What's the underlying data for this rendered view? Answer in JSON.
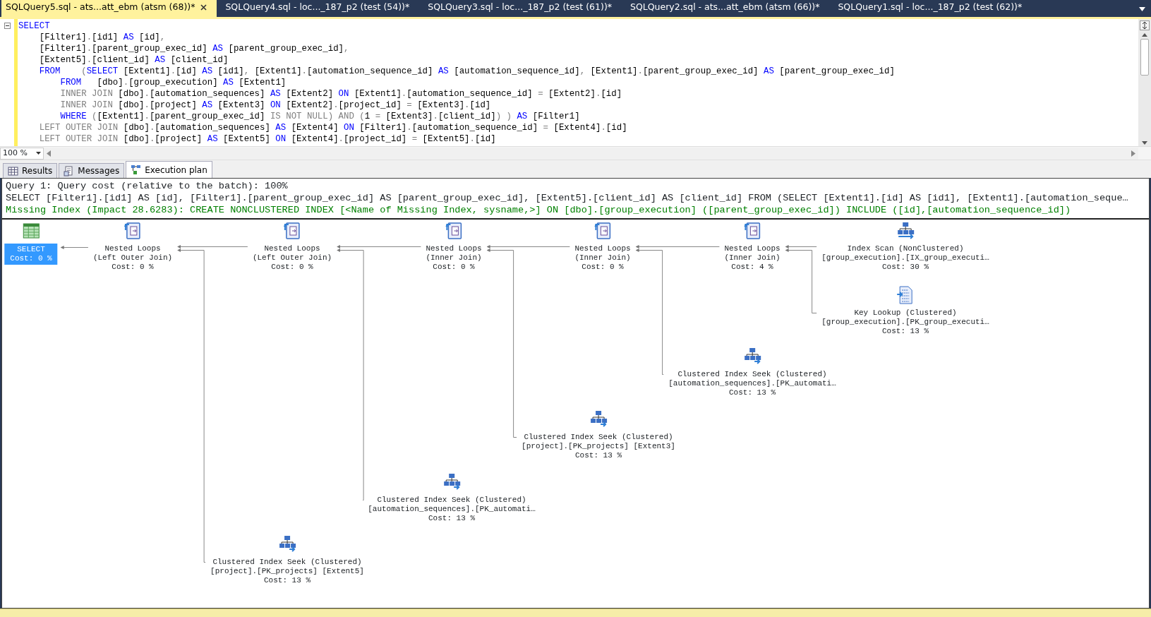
{
  "tabs": [
    {
      "label": "SQLQuery5.sql - ats...att_ebm (atsm (68))*",
      "selected": true
    },
    {
      "label": "SQLQuery4.sql - loc..._187_p2 (test (54))*",
      "selected": false
    },
    {
      "label": "SQLQuery3.sql - loc..._187_p2 (test (61))*",
      "selected": false
    },
    {
      "label": "SQLQuery2.sql - ats...att_ebm (atsm (66))*",
      "selected": false
    },
    {
      "label": "SQLQuery1.sql - loc..._187_p2 (test (62))*",
      "selected": false
    }
  ],
  "editor": {
    "lines": [
      [
        {
          "kind": "kw",
          "text": "SELECT"
        }
      ],
      [
        {
          "kind": "id",
          "text": "    [Filter1]"
        },
        {
          "kind": "op",
          "text": "."
        },
        {
          "kind": "id",
          "text": "[id1]"
        },
        {
          "kind": "kw",
          "text": " AS "
        },
        {
          "kind": "id",
          "text": "[id]"
        },
        {
          "kind": "op",
          "text": ","
        }
      ],
      [
        {
          "kind": "id",
          "text": "    [Filter1]"
        },
        {
          "kind": "op",
          "text": "."
        },
        {
          "kind": "id",
          "text": "[parent_group_exec_id]"
        },
        {
          "kind": "kw",
          "text": " AS "
        },
        {
          "kind": "id",
          "text": "[parent_group_exec_id]"
        },
        {
          "kind": "op",
          "text": ","
        }
      ],
      [
        {
          "kind": "id",
          "text": "    [Extent5]"
        },
        {
          "kind": "op",
          "text": "."
        },
        {
          "kind": "id",
          "text": "[client_id]"
        },
        {
          "kind": "kw",
          "text": " AS "
        },
        {
          "kind": "id",
          "text": "[client_id]"
        }
      ],
      [
        {
          "kind": "kw",
          "text": "    FROM    "
        },
        {
          "kind": "op",
          "text": "("
        },
        {
          "kind": "kw",
          "text": "SELECT "
        },
        {
          "kind": "id",
          "text": "[Extent1]"
        },
        {
          "kind": "op",
          "text": "."
        },
        {
          "kind": "id",
          "text": "[id]"
        },
        {
          "kind": "kw",
          "text": " AS "
        },
        {
          "kind": "id",
          "text": "[id1]"
        },
        {
          "kind": "op",
          "text": ", "
        },
        {
          "kind": "id",
          "text": "[Extent1]"
        },
        {
          "kind": "op",
          "text": "."
        },
        {
          "kind": "id",
          "text": "[automation_sequence_id]"
        },
        {
          "kind": "kw",
          "text": " AS "
        },
        {
          "kind": "id",
          "text": "[automation_sequence_id]"
        },
        {
          "kind": "op",
          "text": ", "
        },
        {
          "kind": "id",
          "text": "[Extent1]"
        },
        {
          "kind": "op",
          "text": "."
        },
        {
          "kind": "id",
          "text": "[parent_group_exec_id]"
        },
        {
          "kind": "kw",
          "text": " AS "
        },
        {
          "kind": "id",
          "text": "[parent_group_exec_id]"
        }
      ],
      [
        {
          "kind": "kw",
          "text": "        FROM   "
        },
        {
          "kind": "id",
          "text": "[dbo]"
        },
        {
          "kind": "op",
          "text": "."
        },
        {
          "kind": "id",
          "text": "[group_execution]"
        },
        {
          "kind": "kw",
          "text": " AS "
        },
        {
          "kind": "id",
          "text": "[Extent1]"
        }
      ],
      [
        {
          "kind": "op",
          "text": "        INNER JOIN "
        },
        {
          "kind": "id",
          "text": "[dbo]"
        },
        {
          "kind": "op",
          "text": "."
        },
        {
          "kind": "id",
          "text": "[automation_sequences]"
        },
        {
          "kind": "kw",
          "text": " AS "
        },
        {
          "kind": "id",
          "text": "[Extent2]"
        },
        {
          "kind": "kw",
          "text": " ON "
        },
        {
          "kind": "id",
          "text": "[Extent1]"
        },
        {
          "kind": "op",
          "text": "."
        },
        {
          "kind": "id",
          "text": "[automation_sequence_id]"
        },
        {
          "kind": "op",
          "text": " = "
        },
        {
          "kind": "id",
          "text": "[Extent2]"
        },
        {
          "kind": "op",
          "text": "."
        },
        {
          "kind": "id",
          "text": "[id]"
        }
      ],
      [
        {
          "kind": "op",
          "text": "        INNER JOIN "
        },
        {
          "kind": "id",
          "text": "[dbo]"
        },
        {
          "kind": "op",
          "text": "."
        },
        {
          "kind": "id",
          "text": "[project]"
        },
        {
          "kind": "kw",
          "text": " AS "
        },
        {
          "kind": "id",
          "text": "[Extent3]"
        },
        {
          "kind": "kw",
          "text": " ON "
        },
        {
          "kind": "id",
          "text": "[Extent2]"
        },
        {
          "kind": "op",
          "text": "."
        },
        {
          "kind": "id",
          "text": "[project_id]"
        },
        {
          "kind": "op",
          "text": " = "
        },
        {
          "kind": "id",
          "text": "[Extent3]"
        },
        {
          "kind": "op",
          "text": "."
        },
        {
          "kind": "id",
          "text": "[id]"
        }
      ],
      [
        {
          "kind": "kw",
          "text": "        WHERE "
        },
        {
          "kind": "op",
          "text": "("
        },
        {
          "kind": "id",
          "text": "[Extent1]"
        },
        {
          "kind": "op",
          "text": "."
        },
        {
          "kind": "id",
          "text": "[parent_group_exec_id]"
        },
        {
          "kind": "op",
          "text": " IS NOT NULL) AND ("
        },
        {
          "kind": "id",
          "text": "1 "
        },
        {
          "kind": "op",
          "text": "= "
        },
        {
          "kind": "id",
          "text": "[Extent3]"
        },
        {
          "kind": "op",
          "text": "."
        },
        {
          "kind": "id",
          "text": "[client_id]"
        },
        {
          "kind": "op",
          "text": ") ) "
        },
        {
          "kind": "kw",
          "text": "AS "
        },
        {
          "kind": "id",
          "text": "[Filter1]"
        }
      ],
      [
        {
          "kind": "op",
          "text": "    LEFT OUTER JOIN "
        },
        {
          "kind": "id",
          "text": "[dbo]"
        },
        {
          "kind": "op",
          "text": "."
        },
        {
          "kind": "id",
          "text": "[automation_sequences]"
        },
        {
          "kind": "kw",
          "text": " AS "
        },
        {
          "kind": "id",
          "text": "[Extent4]"
        },
        {
          "kind": "kw",
          "text": " ON "
        },
        {
          "kind": "id",
          "text": "[Filter1]"
        },
        {
          "kind": "op",
          "text": "."
        },
        {
          "kind": "id",
          "text": "[automation_sequence_id]"
        },
        {
          "kind": "op",
          "text": " = "
        },
        {
          "kind": "id",
          "text": "[Extent4]"
        },
        {
          "kind": "op",
          "text": "."
        },
        {
          "kind": "id",
          "text": "[id]"
        }
      ],
      [
        {
          "kind": "op",
          "text": "    LEFT OUTER JOIN "
        },
        {
          "kind": "id",
          "text": "[dbo]"
        },
        {
          "kind": "op",
          "text": "."
        },
        {
          "kind": "id",
          "text": "[project]"
        },
        {
          "kind": "kw",
          "text": " AS "
        },
        {
          "kind": "id",
          "text": "[Extent5]"
        },
        {
          "kind": "kw",
          "text": " ON "
        },
        {
          "kind": "id",
          "text": "[Extent4]"
        },
        {
          "kind": "op",
          "text": "."
        },
        {
          "kind": "id",
          "text": "[project_id]"
        },
        {
          "kind": "op",
          "text": " = "
        },
        {
          "kind": "id",
          "text": "[Extent5]"
        },
        {
          "kind": "op",
          "text": "."
        },
        {
          "kind": "id",
          "text": "[id]"
        }
      ]
    ],
    "zoom": "100 %"
  },
  "result_tabs": [
    {
      "label": "Results",
      "kind": "results",
      "selected": false
    },
    {
      "label": "Messages",
      "kind": "messages",
      "selected": false
    },
    {
      "label": "Execution plan",
      "kind": "plan",
      "selected": true
    }
  ],
  "plan": {
    "query_cost": "Query 1: Query cost (relative to the batch): 100%",
    "statement": "SELECT [Filter1].[id1] AS [id], [Filter1].[parent_group_exec_id] AS [parent_group_exec_id], [Extent5].[client_id] AS [client_id] FROM (SELECT [Extent1].[id] AS [id1], [Extent1].[automation_seque…",
    "missing_index": "Missing Index (Impact 28.6283): CREATE NONCLUSTERED INDEX [<Name of Missing Index, sysname,>] ON [dbo].[group_execution] ([parent_group_exec_id]) INCLUDE ([id],[automation_sequence_id])",
    "root": {
      "kind": "select",
      "operator": "SELECT",
      "cost": "Cost: 0 %",
      "selected": true,
      "children": [
        {
          "kind": "nested_loops",
          "operator": "Nested Loops",
          "detail": "(Left Outer Join)",
          "cost": "Cost: 0 %",
          "selected": false,
          "children": [
            {
              "kind": "nested_loops",
              "operator": "Nested Loops",
              "detail": "(Left Outer Join)",
              "cost": "Cost: 0 %",
              "selected": false,
              "children": [
                {
                  "kind": "nested_loops",
                  "operator": "Nested Loops",
                  "detail": "(Inner Join)",
                  "cost": "Cost: 0 %",
                  "selected": false,
                  "children": [
                    {
                      "kind": "nested_loops",
                      "operator": "Nested Loops",
                      "detail": "(Inner Join)",
                      "cost": "Cost: 0 %",
                      "selected": false,
                      "children": [
                        {
                          "kind": "nested_loops",
                          "operator": "Nested Loops",
                          "detail": "(Inner Join)",
                          "cost": "Cost: 4 %",
                          "selected": false,
                          "children": [
                            {
                              "kind": "index_scan",
                              "operator": "Index Scan (NonClustered)",
                              "detail": "[group_execution].[IX_group_executi…",
                              "cost": "Cost: 30 %",
                              "selected": false
                            },
                            {
                              "kind": "key_lookup",
                              "operator": "Key Lookup (Clustered)",
                              "detail": "[group_execution].[PK_group_executi…",
                              "cost": "Cost: 13 %",
                              "selected": false
                            }
                          ]
                        },
                        {
                          "kind": "index_seek",
                          "operator": "Clustered Index Seek (Clustered)",
                          "detail": "[automation_sequences].[PK_automati…",
                          "cost": "Cost: 13 %",
                          "selected": false
                        }
                      ]
                    },
                    {
                      "kind": "index_seek",
                      "operator": "Clustered Index Seek (Clustered)",
                      "detail": "[project].[PK_projects] [Extent3]",
                      "cost": "Cost: 13 %",
                      "selected": false
                    }
                  ]
                },
                {
                  "kind": "index_seek",
                  "operator": "Clustered Index Seek (Clustered)",
                  "detail": "[automation_sequences].[PK_automati…",
                  "cost": "Cost: 13 %",
                  "selected": false
                }
              ]
            },
            {
              "kind": "index_seek",
              "operator": "Clustered Index Seek (Clustered)",
              "detail": "[project].[PK_projects] [Extent5]",
              "cost": "Cost: 13 %",
              "selected": false
            }
          ]
        }
      ]
    }
  }
}
